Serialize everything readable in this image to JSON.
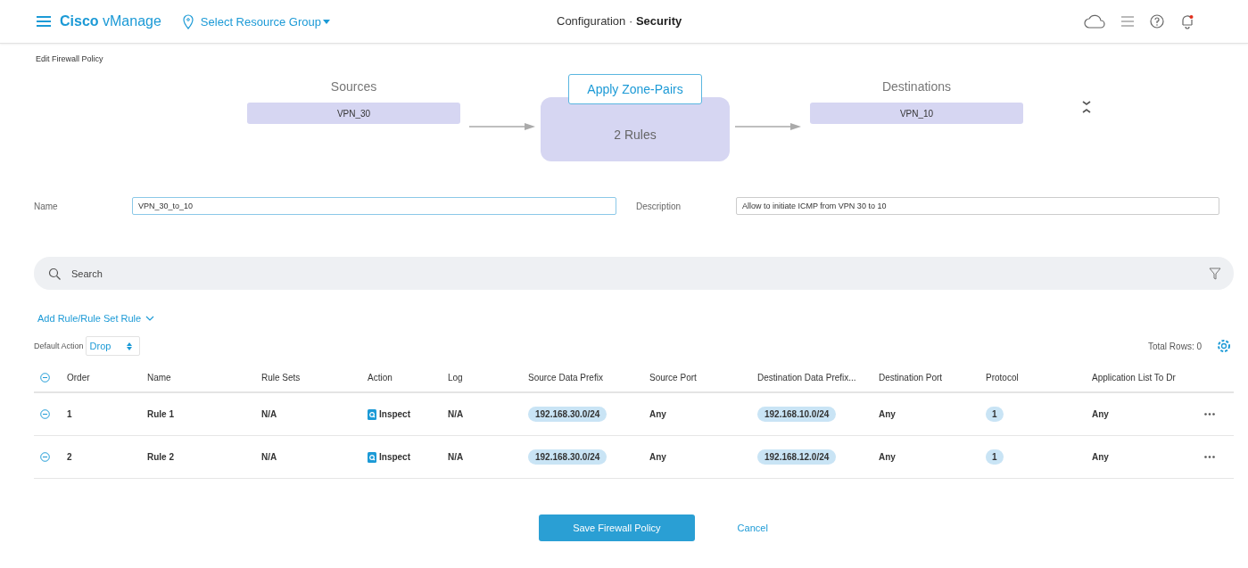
{
  "header": {
    "brand_bold": "Cisco",
    "brand_light": "vManage",
    "resource_group": "Select Resource Group",
    "title_section": "Configuration",
    "title_separator": "·",
    "title_page": "Security"
  },
  "page_title": "Edit Firewall Policy",
  "flow": {
    "sources_label": "Sources",
    "sources": [
      "VPN_30"
    ],
    "apply_button": "Apply Zone-Pairs",
    "rules_count": "2 Rules",
    "destinations_label": "Destinations",
    "destinations": [
      "VPN_10"
    ]
  },
  "form": {
    "name_label": "Name",
    "name_value": "VPN_30_to_10",
    "description_label": "Description",
    "description_value": "Allow to initiate ICMP from VPN 30 to 10"
  },
  "search": {
    "placeholder": "Search"
  },
  "add_rule": "Add Rule/Rule Set Rule",
  "default_action": {
    "label": "Default Action",
    "value": "Drop"
  },
  "total_rows": "Total Rows: 0",
  "table": {
    "columns": [
      "Order",
      "Name",
      "Rule Sets",
      "Action",
      "Log",
      "Source Data Prefix",
      "Source Port",
      "Destination Data Prefix...",
      "Destination Port",
      "Protocol",
      "Application List To Dr"
    ],
    "rows": [
      {
        "order": "1",
        "name": "Rule 1",
        "rule_sets": "N/A",
        "action": "Inspect",
        "log": "N/A",
        "source_prefix": "192.168.30.0/24",
        "source_port": "Any",
        "dest_prefix": "192.168.10.0/24",
        "dest_port": "Any",
        "protocol": "1",
        "app_list": "Any"
      },
      {
        "order": "2",
        "name": "Rule 2",
        "rule_sets": "N/A",
        "action": "Inspect",
        "log": "N/A",
        "source_prefix": "192.168.30.0/24",
        "source_port": "Any",
        "dest_prefix": "192.168.12.0/24",
        "dest_port": "Any",
        "protocol": "1",
        "app_list": "Any"
      }
    ]
  },
  "buttons": {
    "save": "Save Firewall Policy",
    "cancel": "Cancel"
  }
}
